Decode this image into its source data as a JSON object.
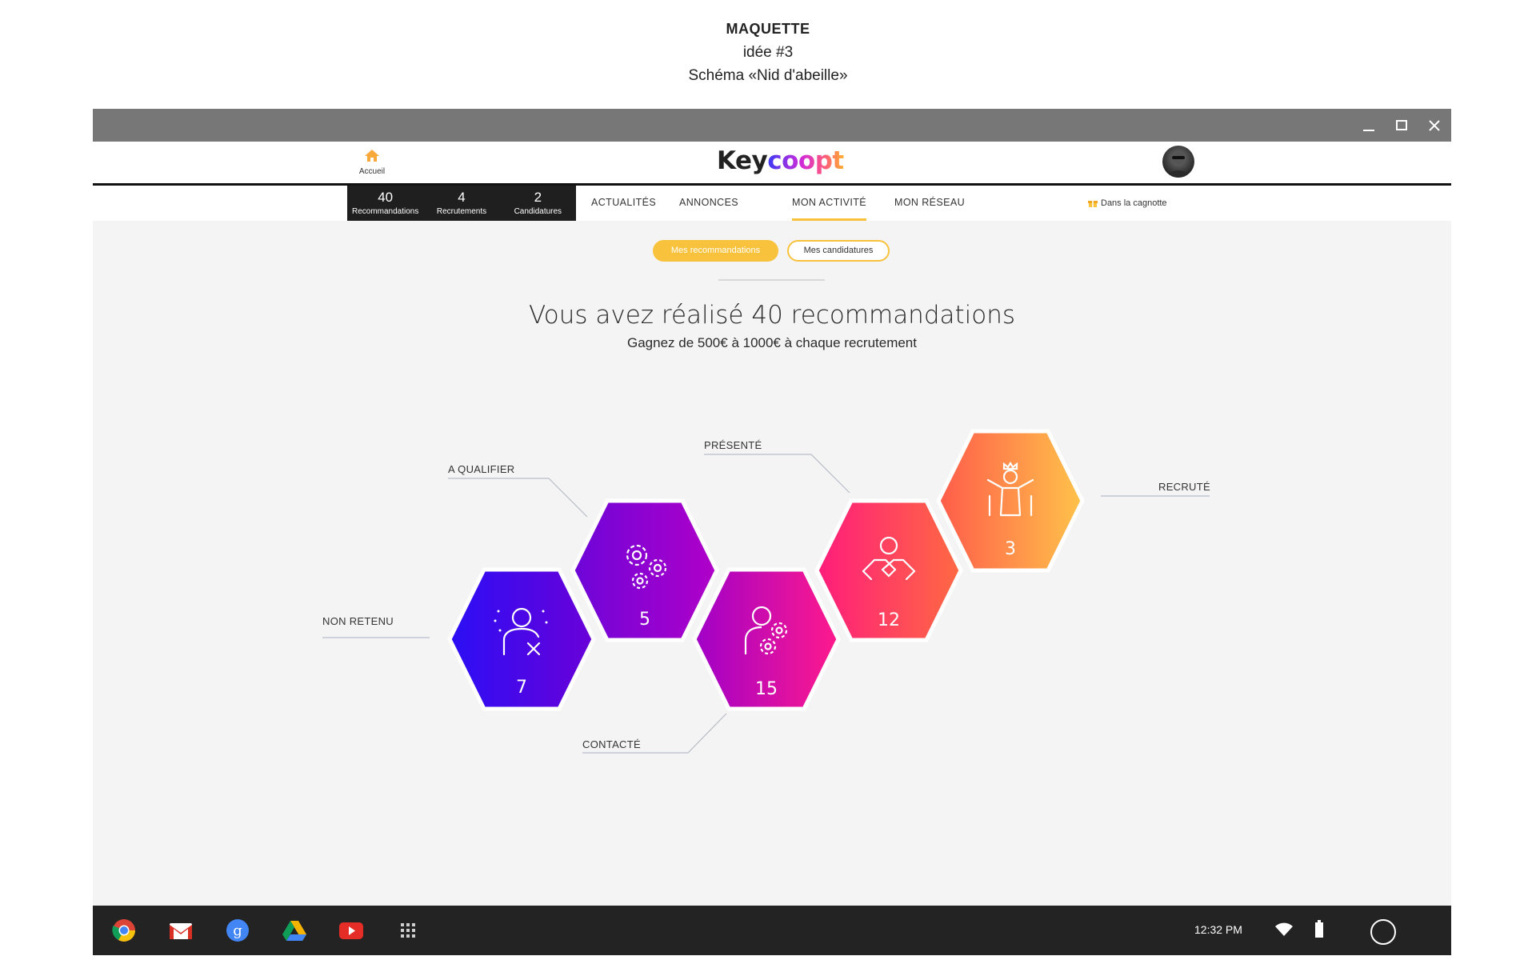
{
  "document": {
    "heading": "MAQUETTE",
    "idea": "idée #3",
    "schema": "Schéma «Nid d'abeille»"
  },
  "window": {
    "controls": [
      "minimize-icon",
      "maximize-icon",
      "close-icon"
    ]
  },
  "header": {
    "home_label": "Accueil",
    "home_icon": "home-icon",
    "logo_part1": "Key",
    "logo_part2": "coopt"
  },
  "stats": [
    {
      "value": "40",
      "label": "Recommandations"
    },
    {
      "value": "4",
      "label": "Recrutements"
    },
    {
      "value": "2",
      "label": "Candidatures"
    }
  ],
  "menu": {
    "items": [
      "ACTUALITÉS",
      "ANNONCES",
      "MON ACTIVITÉ",
      "MON RÉSEAU"
    ],
    "active": "MON ACTIVITÉ",
    "cagnotte": "Dans la cagnotte"
  },
  "tabs": {
    "recommandations": "Mes recommandations",
    "candidatures": "Mes candidatures",
    "active": "Mes recommandations"
  },
  "main": {
    "headline": "Vous avez réalisé 40 recommandations",
    "subline": "Gagnez de 500€ à 1000€ à chaque recrutement"
  },
  "stages": [
    {
      "label": "NON RETENU",
      "count": "7",
      "icon": "person-rejected-icon",
      "color_from": "#2b0ff5",
      "color_to": "#6a00d8"
    },
    {
      "label": "A QUALIFIER",
      "count": "5",
      "icon": "gears-icon",
      "color_from": "#6d05d9",
      "color_to": "#b000c8"
    },
    {
      "label": "CONTACTÉ",
      "count": "15",
      "icon": "person-gears-icon",
      "color_from": "#a000c9",
      "color_to": "#ff1a8c"
    },
    {
      "label": "PRÉSENTÉ",
      "count": "12",
      "icon": "handshake-icon",
      "color_from": "#ff1c7c",
      "color_to": "#ff6a42"
    },
    {
      "label": "RECRUTÉ",
      "count": "3",
      "icon": "winner-icon",
      "color_from": "#ff5c4a",
      "color_to": "#ffc24a"
    }
  ],
  "taskbar": {
    "apps": [
      "chrome-icon",
      "gmail-icon",
      "google-search-icon",
      "drive-icon",
      "youtube-icon",
      "app-launcher-icon"
    ],
    "time": "12:32 PM",
    "status_icons": [
      "wifi-icon",
      "battery-icon",
      "launcher-circle-icon"
    ]
  },
  "colors": {
    "accent": "#f9c23c",
    "titlebar": "#777777",
    "taskbar": "#232323",
    "stats_bg": "#1f1f1f"
  }
}
